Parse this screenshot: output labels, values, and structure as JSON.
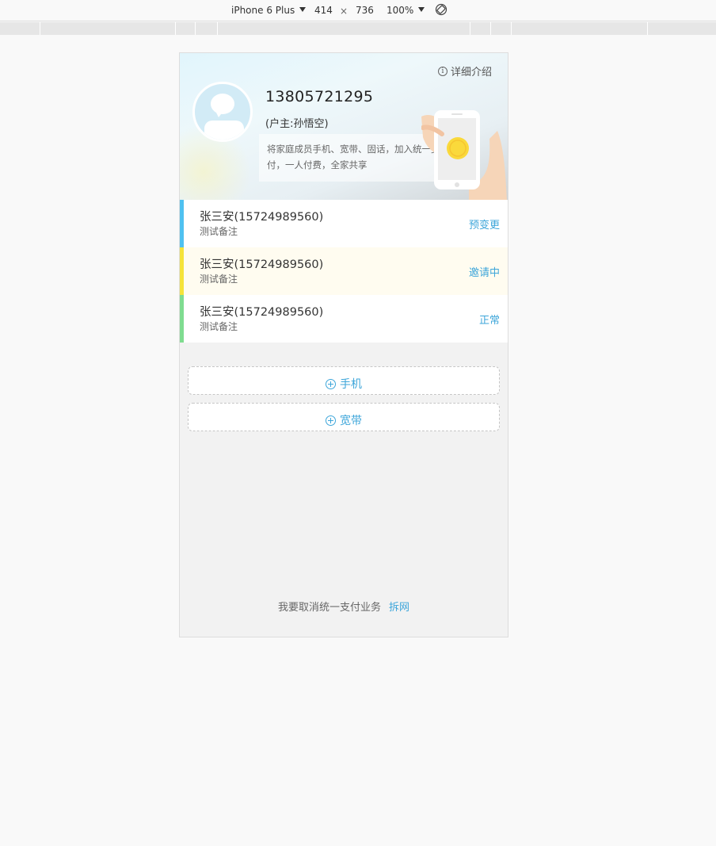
{
  "devtools": {
    "device": "iPhone 6 Plus",
    "width": "414",
    "times": "×",
    "height": "736",
    "zoom": "100%"
  },
  "header": {
    "detail_link": "详细介绍",
    "phone_number": "13805721295",
    "owner_label": "(户主:孙悟空)",
    "promo_line1": "将家庭成员手机、宽带、固话，加入统一支",
    "promo_line2": "付，一人付费，全家共享"
  },
  "members": [
    {
      "name": "张三安(15724989560)",
      "note": "测试备注",
      "status": "预变更",
      "bar_color": "#4fc1f0",
      "bg_color": "#ffffff"
    },
    {
      "name": "张三安(15724989560)",
      "note": "测试备注",
      "status": "邀请中",
      "bar_color": "#f5e33a",
      "bg_color": "#fffcf0"
    },
    {
      "name": "张三安(15724989560)",
      "note": "测试备注",
      "status": "正常",
      "bar_color": "#7fdc90",
      "bg_color": "#ffffff"
    }
  ],
  "add_buttons": {
    "mobile": "手机",
    "broadband": "宽带"
  },
  "footer": {
    "text": "我要取消统一支付业务",
    "link": "拆网"
  },
  "colors": {
    "accent": "#3ea6da"
  }
}
